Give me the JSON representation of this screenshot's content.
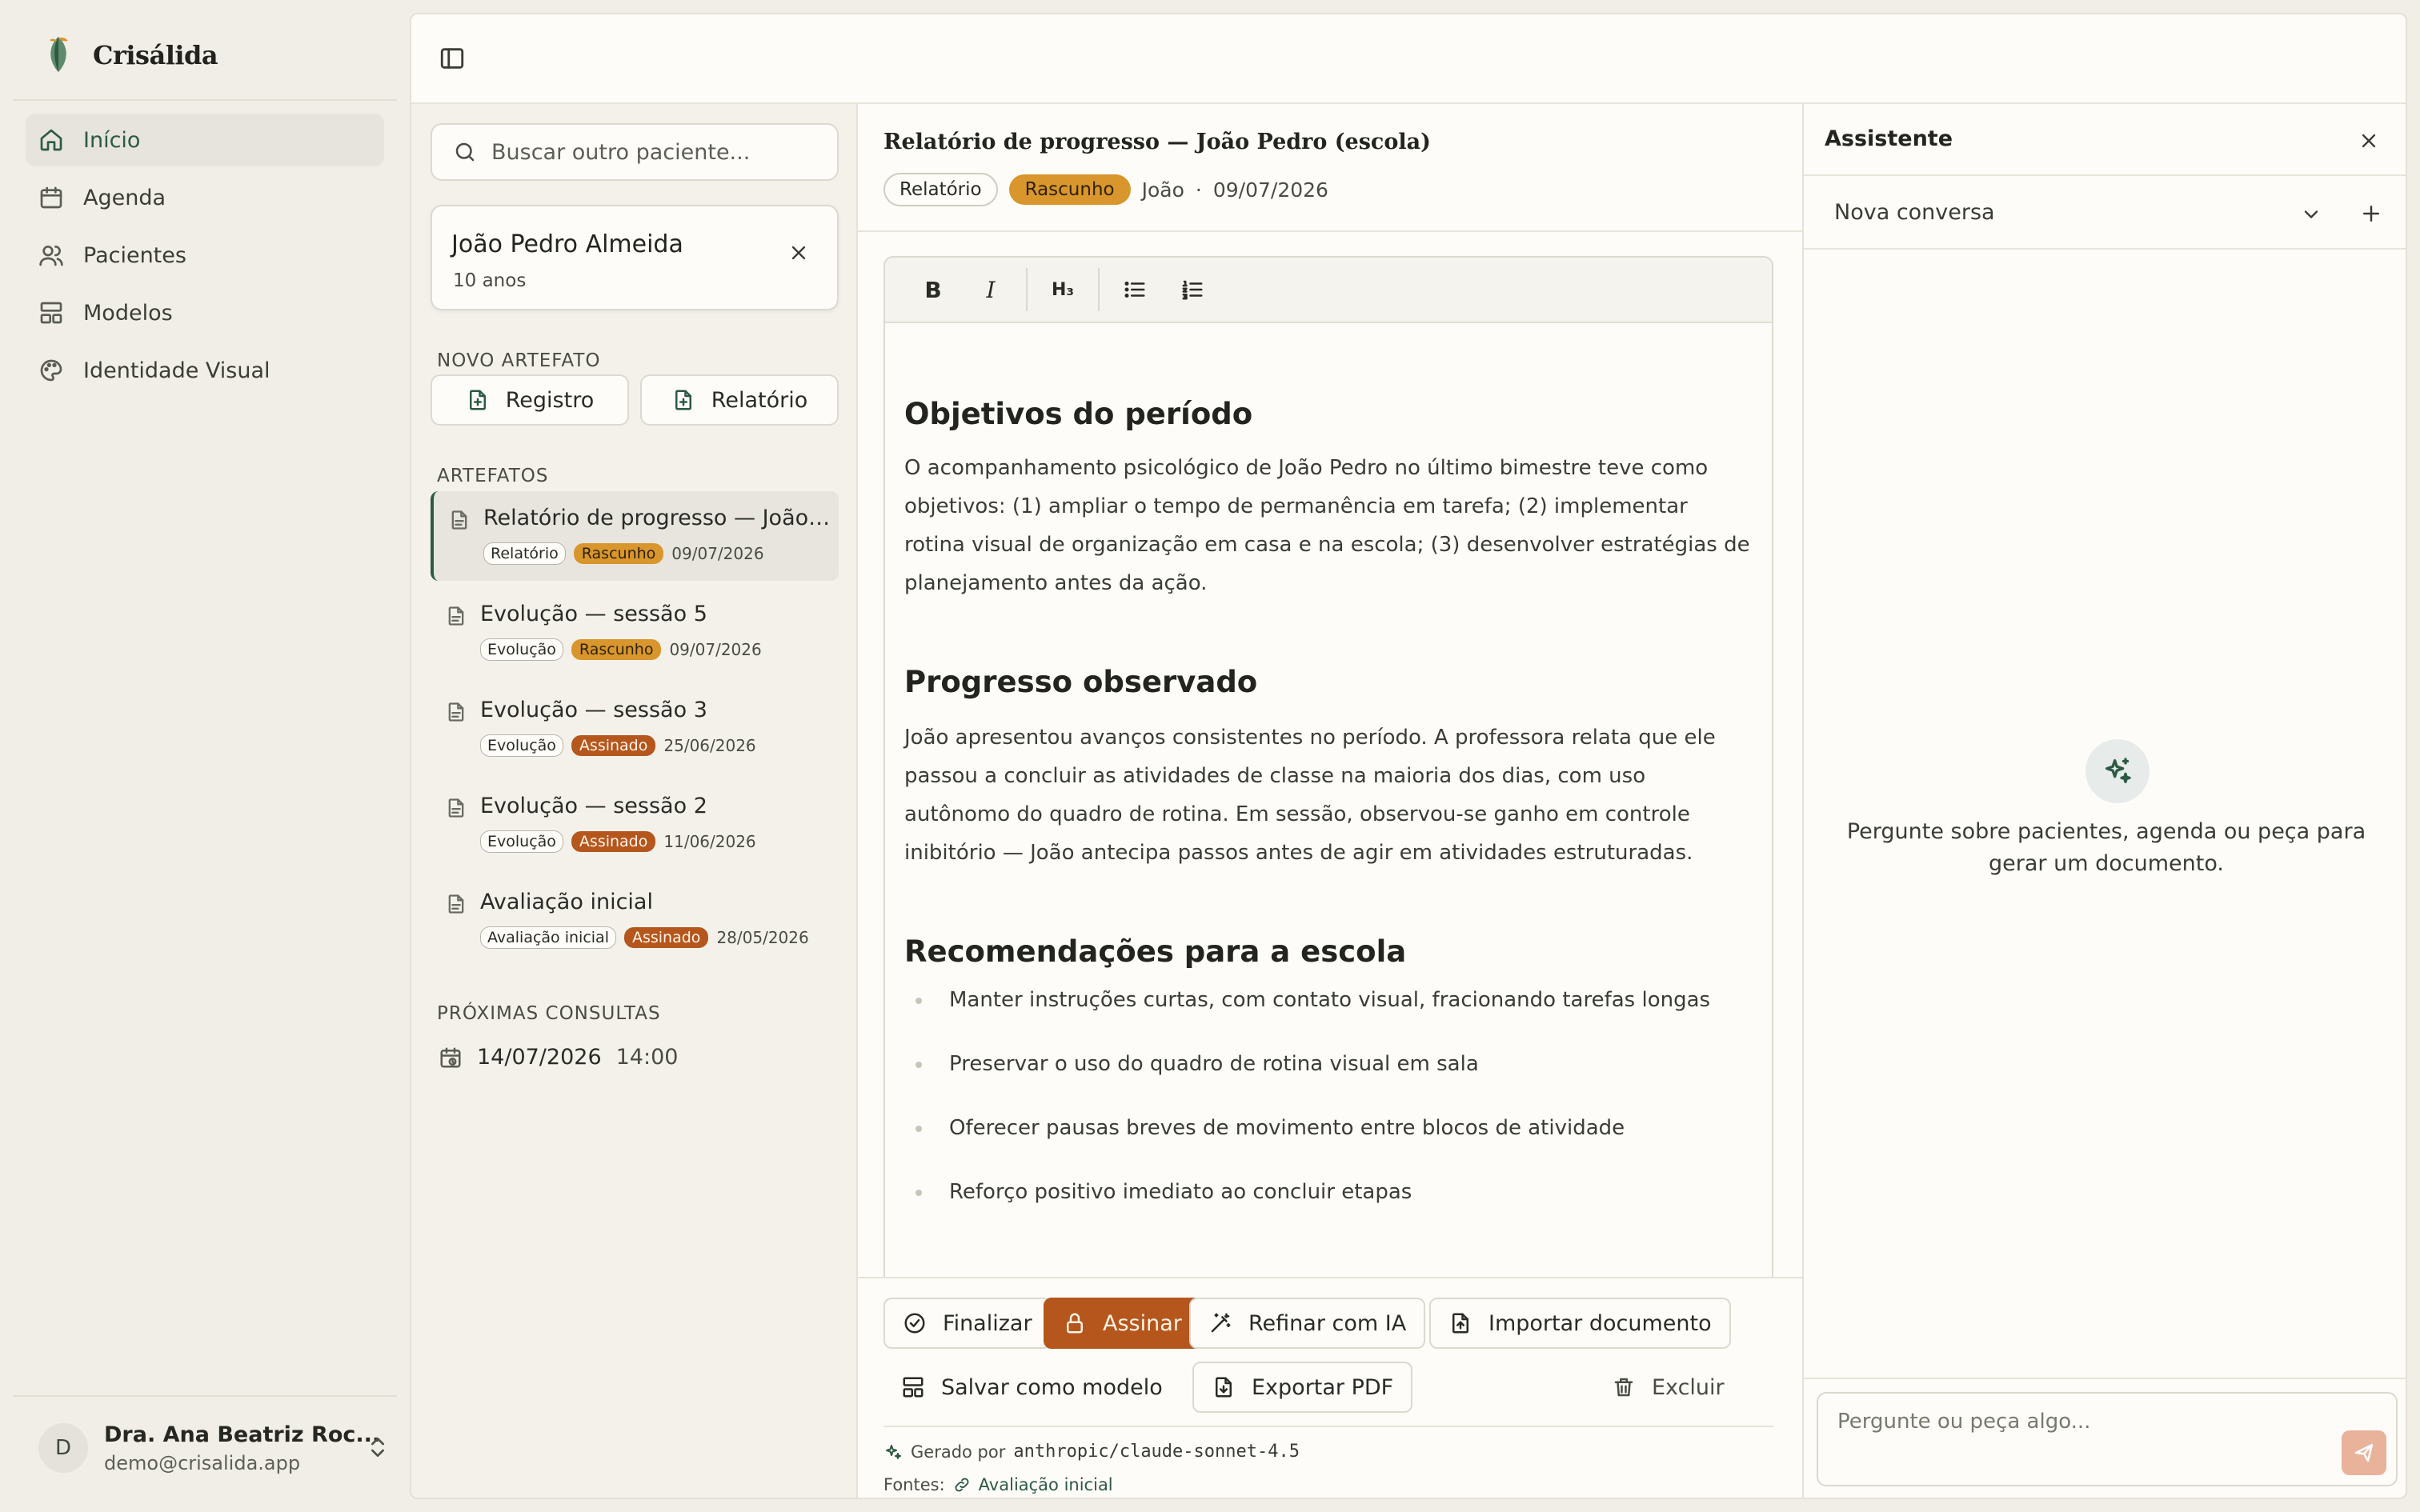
{
  "brand": {
    "name": "Crisálida"
  },
  "nav": {
    "items": [
      {
        "label": "Início",
        "icon": "home-icon",
        "active": true
      },
      {
        "label": "Agenda",
        "icon": "calendar-icon",
        "active": false
      },
      {
        "label": "Pacientes",
        "icon": "users-icon",
        "active": false
      },
      {
        "label": "Modelos",
        "icon": "layout-icon",
        "active": false
      },
      {
        "label": "Identidade Visual",
        "icon": "palette-icon",
        "active": false
      }
    ]
  },
  "user": {
    "initial": "D",
    "name": "Dra. Ana Beatriz Roc...",
    "email": "demo@crisalida.app"
  },
  "patient_panel": {
    "search_placeholder": "Buscar outro paciente...",
    "patient": {
      "name": "João Pedro Almeida",
      "age": "10 anos"
    },
    "new_artifact_heading": "NOVO ARTEFATO",
    "new_buttons": {
      "registro": "Registro",
      "relatorio": "Relatório"
    },
    "artifacts_heading": "ARTEFATOS",
    "artifacts": [
      {
        "title": "Relatório de progresso — João Pedro (escola)",
        "type": "Relatório",
        "status": "Rascunho",
        "date": "09/07/2026"
      },
      {
        "title": "Evolução — sessão 5",
        "type": "Evolução",
        "status": "Rascunho",
        "date": "09/07/2026"
      },
      {
        "title": "Evolução — sessão 3",
        "type": "Evolução",
        "status": "Assinado",
        "date": "25/06/2026"
      },
      {
        "title": "Evolução — sessão 2",
        "type": "Evolução",
        "status": "Assinado",
        "date": "11/06/2026"
      },
      {
        "title": "Avaliação inicial",
        "type": "Avaliação inicial",
        "status": "Assinado",
        "date": "28/05/2026"
      }
    ],
    "appointments_heading": "PRÓXIMAS CONSULTAS",
    "appointment": {
      "date": "14/07/2026",
      "time": "14:00"
    }
  },
  "document": {
    "title": "Relatório de progresso — João Pedro (escola)",
    "type": "Relatório",
    "status": "Rascunho",
    "author": "João",
    "separator": "·",
    "date": "09/07/2026",
    "toolbar": {
      "bold": "B",
      "italic": "I",
      "heading": "H₃"
    },
    "sections": {
      "objectives_heading": "Objetivos do período",
      "objectives_text": "O acompanhamento psicológico de João Pedro no último bimestre teve como objetivos: (1) ampliar o tempo de permanência em tarefa; (2) implementar rotina visual de organização em casa e na escola; (3) desenvolver estratégias de planejamento antes da ação.",
      "progress_heading": "Progresso observado",
      "progress_text": "João apresentou avanços consistentes no período. A professora relata que ele passou a concluir as atividades de classe na maioria dos dias, com uso autônomo do quadro de rotina. Em sessão, observou-se ganho em controle inibitório — João antecipa passos antes de agir em atividades estruturadas.",
      "recommendations_heading": "Recomendações para a escola",
      "recommendations": [
        "Manter instruções curtas, com contato visual, fracionando tarefas longas",
        "Preservar o uso do quadro de rotina visual em sala",
        "Oferecer pausas breves de movimento entre blocos de atividade",
        "Reforço positivo imediato ao concluir etapas"
      ]
    },
    "actions": {
      "finalize": "Finalizar",
      "sign": "Assinar",
      "refine": "Refinar com IA",
      "import": "Importar documento",
      "save_template": "Salvar como modelo",
      "export_pdf": "Exportar PDF",
      "delete": "Excluir"
    },
    "generated_label": "Gerado por",
    "model": "anthropic/claude-sonnet-4.5",
    "sources_label": "Fontes:",
    "source": "Avaliação inicial"
  },
  "assistant": {
    "title": "Assistente",
    "conversation": "Nova conversa",
    "empty_text": "Pergunte sobre pacientes, agenda ou peça para gerar um documento.",
    "input_placeholder": "Pergunte ou peça algo..."
  },
  "colors": {
    "accent_green": "#2d5a43",
    "draft_badge": "#d9962c",
    "signed_badge": "#b5561d",
    "primary_button": "#b5561d",
    "background": "#f0eee6"
  }
}
